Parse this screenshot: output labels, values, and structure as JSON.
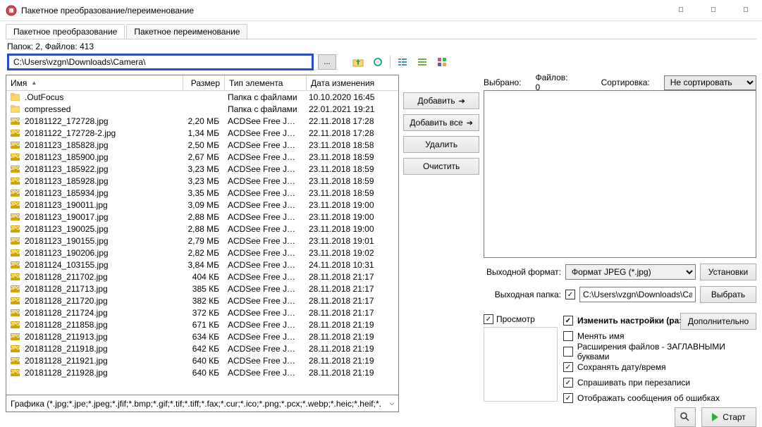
{
  "window": {
    "title": "Пакетное преобразование/переименование"
  },
  "tabs": {
    "convert": "Пакетное преобразование",
    "rename": "Пакетное переименование"
  },
  "folder_info": "Папок: 2, Файлов: 413",
  "path": "C:\\Users\\vzgn\\Downloads\\Camera\\",
  "browse_btn": "...",
  "columns": {
    "name": "Имя",
    "size": "Размер",
    "type": "Тип элемента",
    "date": "Дата изменения"
  },
  "files": [
    {
      "icon": "folder",
      "name": ".OutFocus",
      "size": "",
      "type": "Папка с файлами",
      "date": "10.10.2020 16:45"
    },
    {
      "icon": "folder",
      "name": "compressed",
      "size": "",
      "type": "Папка с файлами",
      "date": "22.01.2021 19:21"
    },
    {
      "icon": "jpg",
      "name": "20181122_172728.jpg",
      "size": "2,20 МБ",
      "type": "ACDSee Free JPEG ...",
      "date": "22.11.2018 17:28"
    },
    {
      "icon": "jpg",
      "name": "20181122_172728-2.jpg",
      "size": "1,34 МБ",
      "type": "ACDSee Free JPEG ...",
      "date": "22.11.2018 17:28"
    },
    {
      "icon": "jpg",
      "name": "20181123_185828.jpg",
      "size": "2,50 МБ",
      "type": "ACDSee Free JPEG ...",
      "date": "23.11.2018 18:58"
    },
    {
      "icon": "jpg",
      "name": "20181123_185900.jpg",
      "size": "2,67 МБ",
      "type": "ACDSee Free JPEG ...",
      "date": "23.11.2018 18:59"
    },
    {
      "icon": "jpg",
      "name": "20181123_185922.jpg",
      "size": "3,23 МБ",
      "type": "ACDSee Free JPEG ...",
      "date": "23.11.2018 18:59"
    },
    {
      "icon": "jpg",
      "name": "20181123_185928.jpg",
      "size": "3,23 МБ",
      "type": "ACDSee Free JPEG ...",
      "date": "23.11.2018 18:59"
    },
    {
      "icon": "jpg",
      "name": "20181123_185934.jpg",
      "size": "3,35 МБ",
      "type": "ACDSee Free JPEG ...",
      "date": "23.11.2018 18:59"
    },
    {
      "icon": "jpg",
      "name": "20181123_190011.jpg",
      "size": "3,09 МБ",
      "type": "ACDSee Free JPEG ...",
      "date": "23.11.2018 19:00"
    },
    {
      "icon": "jpg",
      "name": "20181123_190017.jpg",
      "size": "2,88 МБ",
      "type": "ACDSee Free JPEG ...",
      "date": "23.11.2018 19:00"
    },
    {
      "icon": "jpg",
      "name": "20181123_190025.jpg",
      "size": "2,88 МБ",
      "type": "ACDSee Free JPEG ...",
      "date": "23.11.2018 19:00"
    },
    {
      "icon": "jpg",
      "name": "20181123_190155.jpg",
      "size": "2,79 МБ",
      "type": "ACDSee Free JPEG ...",
      "date": "23.11.2018 19:01"
    },
    {
      "icon": "jpg",
      "name": "20181123_190206.jpg",
      "size": "2,82 МБ",
      "type": "ACDSee Free JPEG ...",
      "date": "23.11.2018 19:02"
    },
    {
      "icon": "jpg",
      "name": "20181124_103155.jpg",
      "size": "3,84 МБ",
      "type": "ACDSee Free JPEG ...",
      "date": "24.11.2018 10:31"
    },
    {
      "icon": "jpg",
      "name": "20181128_211702.jpg",
      "size": "404 КБ",
      "type": "ACDSee Free JPEG ...",
      "date": "28.11.2018 21:17"
    },
    {
      "icon": "jpg",
      "name": "20181128_211713.jpg",
      "size": "385 КБ",
      "type": "ACDSee Free JPEG ...",
      "date": "28.11.2018 21:17"
    },
    {
      "icon": "jpg",
      "name": "20181128_211720.jpg",
      "size": "382 КБ",
      "type": "ACDSee Free JPEG ...",
      "date": "28.11.2018 21:17"
    },
    {
      "icon": "jpg",
      "name": "20181128_211724.jpg",
      "size": "372 КБ",
      "type": "ACDSee Free JPEG ...",
      "date": "28.11.2018 21:17"
    },
    {
      "icon": "jpg",
      "name": "20181128_211858.jpg",
      "size": "671 КБ",
      "type": "ACDSee Free JPEG ...",
      "date": "28.11.2018 21:19"
    },
    {
      "icon": "jpg",
      "name": "20181128_211913.jpg",
      "size": "634 КБ",
      "type": "ACDSee Free JPEG ...",
      "date": "28.11.2018 21:19"
    },
    {
      "icon": "jpg",
      "name": "20181128_211918.jpg",
      "size": "642 КБ",
      "type": "ACDSee Free JPEG ...",
      "date": "28.11.2018 21:19"
    },
    {
      "icon": "jpg",
      "name": "20181128_211921.jpg",
      "size": "640 КБ",
      "type": "ACDSee Free JPEG ...",
      "date": "28.11.2018 21:19"
    },
    {
      "icon": "jpg",
      "name": "20181128_211928.jpg",
      "size": "640 КБ",
      "type": "ACDSee Free JPEG ...",
      "date": "28.11.2018 21:19"
    }
  ],
  "filter_text": "Графика (*.jpg;*.jpe;*.jpeg;*.jfif;*.bmp;*.gif;*.tif;*.tiff;*.fax;*.cur;*.ico;*.png;*.pcx;*.webp;*.heic;*.heif;*.",
  "buttons": {
    "add": "Добавить",
    "add_all": "Добавить все",
    "remove": "Удалить",
    "clear": "Очистить",
    "settings": "Установки",
    "choose": "Выбрать",
    "advanced": "Дополнительно",
    "start": "Старт"
  },
  "labels": {
    "selected": "Выбрано:",
    "files": "Файлов: 0",
    "sort": "Сортировка:",
    "sort_value": "Не сортировать",
    "out_format": "Выходной формат:",
    "out_format_value": "Формат JPEG (*.jpg)",
    "out_folder": "Выходная папка:",
    "out_folder_value": "C:\\Users\\vzgn\\Downloads\\Camera\\compressed\\",
    "preview": "Просмотр"
  },
  "options": {
    "change_settings": "Изменить настройки (размеры...)",
    "rename": "Менять имя",
    "upper_ext": "Расширения файлов - ЗАГЛАВНЫМИ буквами",
    "keep_date": "Сохранять дату/время",
    "ask_overwrite": "Спрашивать при перезаписи",
    "show_errors": "Отображать сообщения об ошибках"
  }
}
